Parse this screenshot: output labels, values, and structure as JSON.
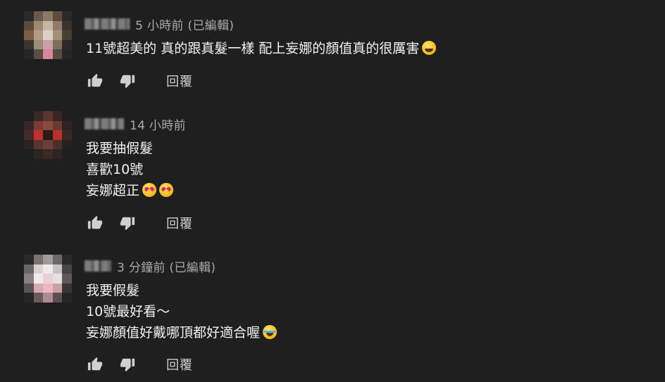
{
  "reply_label": "回覆",
  "comments": [
    {
      "username_blurred": "█████",
      "time": "5 小時前 (已編輯)",
      "lines": [
        "11號超美的 真的跟真髮一樣 配上妄娜的顏值真的很厲害"
      ],
      "emoji": [
        "grinning-squinting-face"
      ]
    },
    {
      "username_blurred": "██████",
      "time": "14 小時前",
      "lines": [
        "我要抽假髮",
        "喜歡10號",
        "妄娜超正"
      ],
      "emoji": [
        "smiling-face-with-heart-eyes",
        "smiling-face-with-heart-eyes"
      ]
    },
    {
      "username_blurred": "███",
      "time": "3 分鐘前 (已編輯)",
      "lines": [
        "我要假髮",
        "10號最好看～",
        "妄娜顏值好戴哪頂都好適合喔"
      ],
      "emoji": [
        "face-with-tears-of-joy"
      ]
    }
  ],
  "colors": {
    "background": "#1f1f1f",
    "text": "#f1f1f1",
    "meta": "#aaaaaa",
    "icon": "#cfcfcf"
  }
}
